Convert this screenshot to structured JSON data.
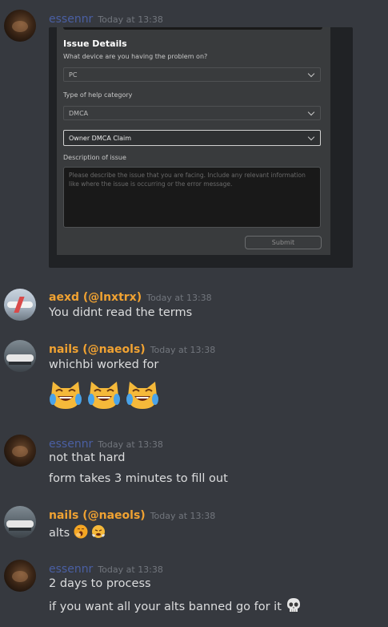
{
  "messages": [
    {
      "user": "essennr",
      "time": "Today at 13:38",
      "embed": {
        "title": "Issue Details",
        "device_label": "What device are you having the problem on?",
        "device_value": "PC",
        "category_label": "Type of help category",
        "category_value": "DMCA",
        "subcategory_value": "Owner DMCA Claim",
        "description_label": "Description of issue",
        "description_placeholder": "Please describe the issue that you are facing. Include any relevant information like where the issue is occurring or the error message.",
        "submit_label": "Submit"
      }
    },
    {
      "user": "aexd (@lnxtrx)",
      "time": "Today at 13:38",
      "lines": [
        "You didnt read the terms"
      ]
    },
    {
      "user": "nails (@naeols)",
      "time": "Today at 13:38",
      "lines": [
        "whichbi worked for"
      ],
      "emoji": [
        "joy-cat-emoji",
        "joy-cat-emoji",
        "joy-cat-emoji"
      ]
    },
    {
      "user": "essennr",
      "time": "Today at 13:38",
      "lines": [
        "not that hard",
        "form takes 3 minutes to fill out"
      ]
    },
    {
      "user": "nails (@naeols)",
      "time": "Today at 13:38",
      "lines": [
        "alts"
      ],
      "emoji": [
        "yawning-face-emoji",
        "face-with-steam-emoji"
      ]
    },
    {
      "user": "essennr",
      "time": "Today at 13:38",
      "lines": [
        "2 days to process",
        "if you want all your alts banned go for it"
      ],
      "emoji": [
        "skull-emoji"
      ]
    }
  ],
  "colors": {
    "background": "#36393f",
    "username_blue": "#4a5fa3",
    "username_orange": "#f0a232",
    "text": "#dcddde",
    "timestamp": "#72767d"
  }
}
